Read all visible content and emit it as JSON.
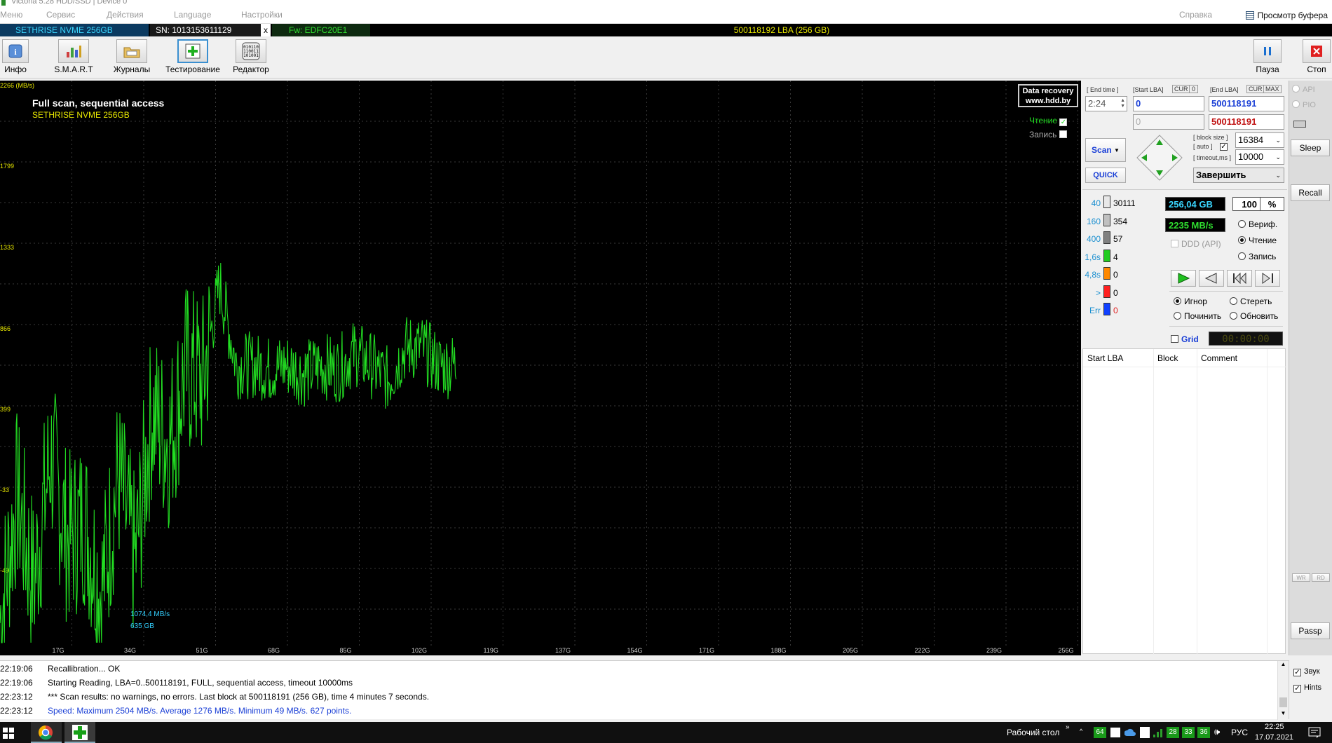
{
  "window": {
    "title": "Victoria 5.28 HDD/SSD | Device 0"
  },
  "menu": {
    "items": [
      "Меню",
      "Сервис",
      "Действия",
      "Language",
      "Настройки"
    ],
    "help": "Справка",
    "clipboard": "Просмотр буфера"
  },
  "device": {
    "name": "SETHRISE NVME 256GB",
    "sn": "SN: 1013153611129",
    "close": "x",
    "fw": "Fw: EDFC20E1",
    "lba": "500118192 LBA (256 GB)"
  },
  "toolbar": {
    "info": "Инфо",
    "smart": "S.M.A.R.T",
    "logs": "Журналы",
    "test": "Тестирование",
    "editor": "Редактор",
    "pause": "Пауза",
    "stop": "Стоп"
  },
  "graph": {
    "unit_label": "2266 (MB/s)",
    "title": "Full scan, sequential access",
    "device": "SETHRISE NVME 256GB",
    "badge_line1": "Data recovery",
    "badge_line2": "www.hdd.by",
    "legend_read": "Чтение",
    "legend_write": "Запись",
    "marker_speed": "1074,4 MB/s",
    "marker_pos": "635 GB",
    "colors": {
      "trace": "#22dd22",
      "grid": "#3a3a3a",
      "title": "#ffffff",
      "device": "#e8e800",
      "ticks": "#cccccc",
      "marker": "#33d0ff"
    }
  },
  "chart_data": {
    "type": "line",
    "xlabel": "",
    "ylabel": "(MB/s)",
    "y_ticks": [
      "1799",
      "1333",
      "866",
      "399",
      "-33",
      "-49"
    ],
    "x_ticks": [
      "17G",
      "34G",
      "51G",
      "68G",
      "85G",
      "102G",
      "119G",
      "137G",
      "154G",
      "171G",
      "188G",
      "205G",
      "222G",
      "239G",
      "256G"
    ],
    "series": [
      {
        "name": "Чтение",
        "x": [
          0,
          4,
          8,
          12,
          16,
          20,
          24,
          28,
          32,
          36,
          40,
          44,
          48,
          52,
          56,
          60,
          64,
          68,
          72,
          76,
          80,
          84,
          88,
          92,
          96,
          100,
          104,
          108
        ],
        "values": [
          120,
          700,
          300,
          900,
          500,
          600,
          250,
          800,
          400,
          1100,
          950,
          1300,
          1250,
          1700,
          1320,
          1320,
          1300,
          1320,
          1280,
          1320,
          1300,
          1380,
          1320,
          1250,
          1400,
          1400,
          1320,
          1320
        ]
      }
    ],
    "stats": {
      "max": 2504,
      "avg": 1276,
      "min": 49,
      "points": 627
    }
  },
  "scan": {
    "end_time_label": "[ End time ]",
    "end_time": "2:24",
    "start_lba_label": "[Start LBA]",
    "cur": "CUR",
    "zero": "0",
    "start_lba": "0",
    "start_lba2": "0",
    "end_lba_label": "[End LBA]",
    "max": "MAX",
    "end_lba": "500118191",
    "end_lba2": "500118191",
    "scan_btn": "Scan",
    "quick_btn": "QUICK",
    "block_size_label": "[ block size ]",
    "auto_label": "[ auto ]",
    "timeout_label": "[ timeout,ms ]",
    "block_size": "16384",
    "timeout": "10000",
    "finish_action": "Завершить",
    "gb_done": "256,04 GB",
    "percent": "100",
    "percent_sign": "%",
    "speed": "2235 MB/s",
    "verify": "Вериф.",
    "read": "Чтение",
    "write": "Запись",
    "ddd": "DDD (API)",
    "ignore": "Игнор",
    "erase": "Стереть",
    "repair": "Починить",
    "refresh": "Обновить",
    "grid": "Grid",
    "timer": "00:00:00"
  },
  "buckets": [
    {
      "label": "40",
      "count": "30111",
      "color": "#e8e8e8"
    },
    {
      "label": "160",
      "count": "354",
      "color": "#c0c0c0"
    },
    {
      "label": "400",
      "count": "57",
      "color": "#808080"
    },
    {
      "label": "1,6s",
      "count": "4",
      "color": "#22cc22"
    },
    {
      "label": "4,8s",
      "count": "0",
      "color": "#ff8800"
    },
    {
      "label": ">",
      "count": "0",
      "color": "#ff2020"
    },
    {
      "label": "Err",
      "count": "0",
      "color": "#1040ff"
    }
  ],
  "table": {
    "headers": [
      "Start LBA",
      "Block",
      "Comment"
    ]
  },
  "sidebar": {
    "api": "API",
    "pio": "PIO",
    "sleep": "Sleep",
    "recall": "Recall",
    "wr": "WR",
    "rd": "RD",
    "passp": "Passp",
    "sound": "Звук",
    "hints": "Hints"
  },
  "log": [
    {
      "time": "22:19:06",
      "text": "Recallibration... OK",
      "color": "#000000"
    },
    {
      "time": "22:19:06",
      "text": "Starting Reading, LBA=0..500118191, FULL, sequential access, timeout 10000ms",
      "color": "#000000"
    },
    {
      "time": "22:23:12",
      "text": "*** Scan results: no warnings, no errors. Last block at 500118191 (256 GB), time 4 minutes 7 seconds.",
      "color": "#000000"
    },
    {
      "time": "22:23:12",
      "text": "Speed: Maximum 2504 MB/s. Average 1276 MB/s. Minimum 49 MB/s. 627 points.",
      "color": "#1a3fd6"
    }
  ],
  "taskbar": {
    "desktop": "Рабочий стол",
    "tray_64": "64",
    "tray_28": "28",
    "tray_33": "33",
    "tray_36": "36",
    "lang": "РУС",
    "time": "22:25",
    "date": "17.07.2021"
  }
}
